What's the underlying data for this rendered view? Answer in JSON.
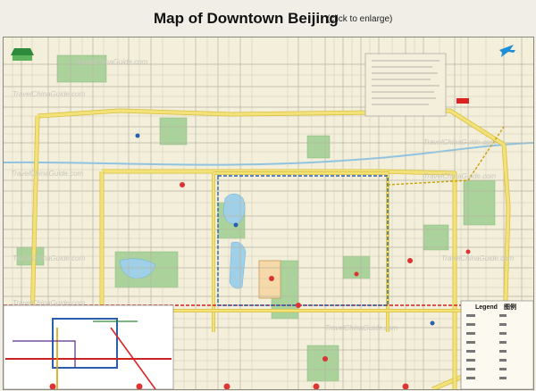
{
  "page": {
    "title": "Map of Downtown Beijing",
    "enlarge_link": "(click to enlarge)"
  },
  "map": {
    "watermark": "TravelChinaGuide.com",
    "legend_title": "Legend",
    "legend_title_cn": "图例",
    "colors": {
      "background": "#f3efdb",
      "ring_road": "#f3e27a",
      "ring_road_edge": "#d8c042",
      "street": "#b9b4a3",
      "park": "#a9d39a",
      "water": "#9fd0ea",
      "forbidden_city": "#f6d9a8"
    },
    "icons": [
      "logo-icon",
      "airplane-icon",
      "subway-map-icon",
      "legend-icon"
    ]
  }
}
